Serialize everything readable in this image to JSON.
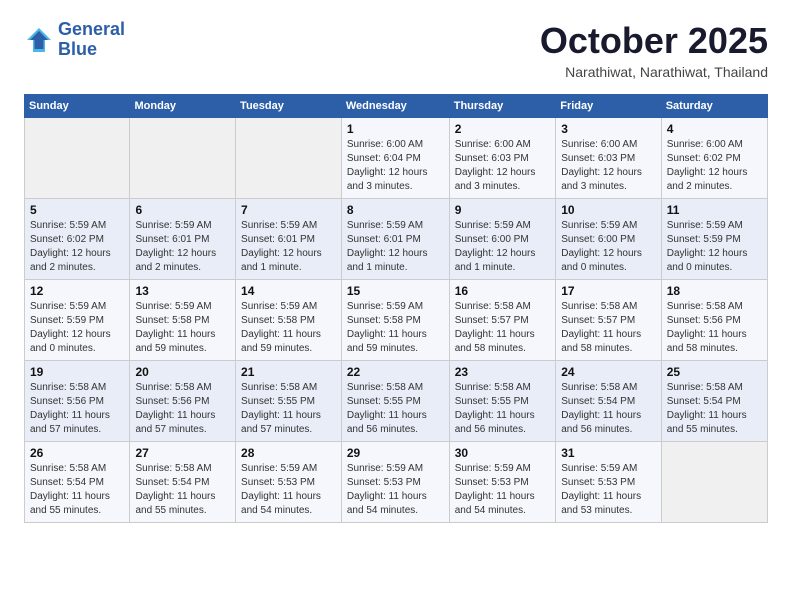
{
  "header": {
    "logo_line1": "General",
    "logo_line2": "Blue",
    "month": "October 2025",
    "location": "Narathiwat, Narathiwat, Thailand"
  },
  "weekdays": [
    "Sunday",
    "Monday",
    "Tuesday",
    "Wednesday",
    "Thursday",
    "Friday",
    "Saturday"
  ],
  "weeks": [
    [
      {
        "day": "",
        "info": ""
      },
      {
        "day": "",
        "info": ""
      },
      {
        "day": "",
        "info": ""
      },
      {
        "day": "1",
        "info": "Sunrise: 6:00 AM\nSunset: 6:04 PM\nDaylight: 12 hours\nand 3 minutes."
      },
      {
        "day": "2",
        "info": "Sunrise: 6:00 AM\nSunset: 6:03 PM\nDaylight: 12 hours\nand 3 minutes."
      },
      {
        "day": "3",
        "info": "Sunrise: 6:00 AM\nSunset: 6:03 PM\nDaylight: 12 hours\nand 3 minutes."
      },
      {
        "day": "4",
        "info": "Sunrise: 6:00 AM\nSunset: 6:02 PM\nDaylight: 12 hours\nand 2 minutes."
      }
    ],
    [
      {
        "day": "5",
        "info": "Sunrise: 5:59 AM\nSunset: 6:02 PM\nDaylight: 12 hours\nand 2 minutes."
      },
      {
        "day": "6",
        "info": "Sunrise: 5:59 AM\nSunset: 6:01 PM\nDaylight: 12 hours\nand 2 minutes."
      },
      {
        "day": "7",
        "info": "Sunrise: 5:59 AM\nSunset: 6:01 PM\nDaylight: 12 hours\nand 1 minute."
      },
      {
        "day": "8",
        "info": "Sunrise: 5:59 AM\nSunset: 6:01 PM\nDaylight: 12 hours\nand 1 minute."
      },
      {
        "day": "9",
        "info": "Sunrise: 5:59 AM\nSunset: 6:00 PM\nDaylight: 12 hours\nand 1 minute."
      },
      {
        "day": "10",
        "info": "Sunrise: 5:59 AM\nSunset: 6:00 PM\nDaylight: 12 hours\nand 0 minutes."
      },
      {
        "day": "11",
        "info": "Sunrise: 5:59 AM\nSunset: 5:59 PM\nDaylight: 12 hours\nand 0 minutes."
      }
    ],
    [
      {
        "day": "12",
        "info": "Sunrise: 5:59 AM\nSunset: 5:59 PM\nDaylight: 12 hours\nand 0 minutes."
      },
      {
        "day": "13",
        "info": "Sunrise: 5:59 AM\nSunset: 5:58 PM\nDaylight: 11 hours\nand 59 minutes."
      },
      {
        "day": "14",
        "info": "Sunrise: 5:59 AM\nSunset: 5:58 PM\nDaylight: 11 hours\nand 59 minutes."
      },
      {
        "day": "15",
        "info": "Sunrise: 5:59 AM\nSunset: 5:58 PM\nDaylight: 11 hours\nand 59 minutes."
      },
      {
        "day": "16",
        "info": "Sunrise: 5:58 AM\nSunset: 5:57 PM\nDaylight: 11 hours\nand 58 minutes."
      },
      {
        "day": "17",
        "info": "Sunrise: 5:58 AM\nSunset: 5:57 PM\nDaylight: 11 hours\nand 58 minutes."
      },
      {
        "day": "18",
        "info": "Sunrise: 5:58 AM\nSunset: 5:56 PM\nDaylight: 11 hours\nand 58 minutes."
      }
    ],
    [
      {
        "day": "19",
        "info": "Sunrise: 5:58 AM\nSunset: 5:56 PM\nDaylight: 11 hours\nand 57 minutes."
      },
      {
        "day": "20",
        "info": "Sunrise: 5:58 AM\nSunset: 5:56 PM\nDaylight: 11 hours\nand 57 minutes."
      },
      {
        "day": "21",
        "info": "Sunrise: 5:58 AM\nSunset: 5:55 PM\nDaylight: 11 hours\nand 57 minutes."
      },
      {
        "day": "22",
        "info": "Sunrise: 5:58 AM\nSunset: 5:55 PM\nDaylight: 11 hours\nand 56 minutes."
      },
      {
        "day": "23",
        "info": "Sunrise: 5:58 AM\nSunset: 5:55 PM\nDaylight: 11 hours\nand 56 minutes."
      },
      {
        "day": "24",
        "info": "Sunrise: 5:58 AM\nSunset: 5:54 PM\nDaylight: 11 hours\nand 56 minutes."
      },
      {
        "day": "25",
        "info": "Sunrise: 5:58 AM\nSunset: 5:54 PM\nDaylight: 11 hours\nand 55 minutes."
      }
    ],
    [
      {
        "day": "26",
        "info": "Sunrise: 5:58 AM\nSunset: 5:54 PM\nDaylight: 11 hours\nand 55 minutes."
      },
      {
        "day": "27",
        "info": "Sunrise: 5:58 AM\nSunset: 5:54 PM\nDaylight: 11 hours\nand 55 minutes."
      },
      {
        "day": "28",
        "info": "Sunrise: 5:59 AM\nSunset: 5:53 PM\nDaylight: 11 hours\nand 54 minutes."
      },
      {
        "day": "29",
        "info": "Sunrise: 5:59 AM\nSunset: 5:53 PM\nDaylight: 11 hours\nand 54 minutes."
      },
      {
        "day": "30",
        "info": "Sunrise: 5:59 AM\nSunset: 5:53 PM\nDaylight: 11 hours\nand 54 minutes."
      },
      {
        "day": "31",
        "info": "Sunrise: 5:59 AM\nSunset: 5:53 PM\nDaylight: 11 hours\nand 53 minutes."
      },
      {
        "day": "",
        "info": ""
      }
    ]
  ]
}
